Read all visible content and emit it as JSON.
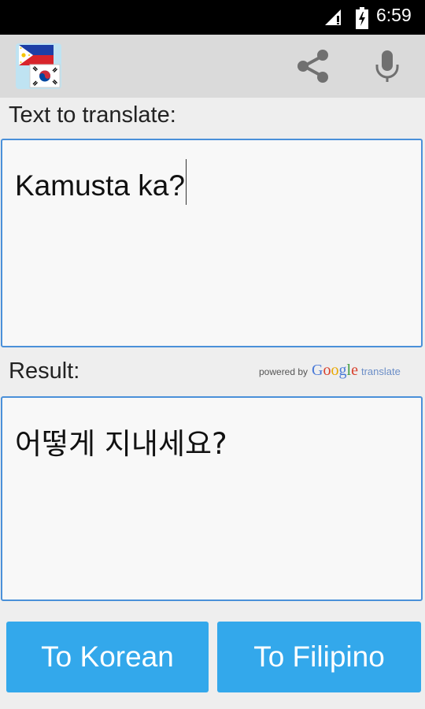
{
  "status_bar": {
    "time": "6:59",
    "icons": [
      "signal-icon",
      "battery-icon"
    ]
  },
  "action_bar": {
    "app_icon": "philippines-korea-flags-icon",
    "actions": [
      "share-icon",
      "microphone-icon"
    ]
  },
  "input": {
    "label": "Text to translate:",
    "value": "Kamusta ka?"
  },
  "result": {
    "label": "Result:",
    "value": "어떻게 지내세요?",
    "powered_by": {
      "prefix": "powered by",
      "brand": "Google",
      "suffix": "translate"
    }
  },
  "buttons": {
    "to_korean": "To Korean",
    "to_filipino": "To Filipino"
  },
  "colors": {
    "accent": "#33a8eb",
    "panel_border": "#4a90d9",
    "action_bar": "#dadada"
  }
}
